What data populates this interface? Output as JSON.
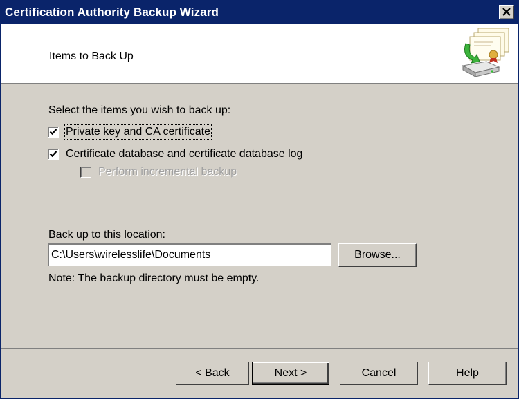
{
  "window": {
    "title": "Certification Authority Backup Wizard",
    "close_label": "X"
  },
  "header": {
    "subtitle": "Items to Back Up",
    "icon": "certificate-backup-icon"
  },
  "items": {
    "prompt": "Select the items you wish to back up:",
    "options": [
      {
        "label": "Private key and CA certificate",
        "checked": true,
        "enabled": true
      },
      {
        "label": "Certificate database and certificate database log",
        "checked": true,
        "enabled": true
      },
      {
        "label": "Perform incremental backup",
        "checked": false,
        "enabled": false
      }
    ]
  },
  "location": {
    "label": "Back up to this location:",
    "value": "C:\\Users\\wirelesslife\\Documents",
    "browse_label": "Browse...",
    "note": "Note: The backup directory must be empty."
  },
  "footer": {
    "back_label": "< Back",
    "next_label": "Next >",
    "cancel_label": "Cancel",
    "help_label": "Help"
  },
  "colors": {
    "titlebar": "#0a246a",
    "face": "#d4d0c8",
    "header_bg": "#ffffff"
  }
}
